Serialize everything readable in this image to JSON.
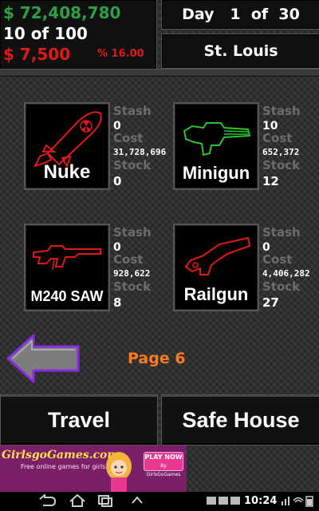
{
  "status": {
    "cash": "$ 72,408,780",
    "capacity": "10  of  100",
    "debt": "$ 7,500",
    "interest": "% 16.00"
  },
  "day": {
    "text": "Day   1  of  30"
  },
  "city": "St. Louis",
  "stat_labels": {
    "stash": "Stash",
    "cost": "Cost",
    "stock": "Stock"
  },
  "items": [
    {
      "name": "Nuke",
      "stash": "0",
      "cost": "31,728,696",
      "stock": "0",
      "outline_color": "#e01818"
    },
    {
      "name": "Minigun",
      "stash": "10",
      "cost": "652,372",
      "stock": "12",
      "outline_color": "#27c42a"
    },
    {
      "name": "M240 SAW",
      "stash": "0",
      "cost": "928,622",
      "stock": "8",
      "outline_color": "#e01818"
    },
    {
      "name": "Railgun",
      "stash": "0",
      "cost": "4,406,282",
      "stock": "27",
      "outline_color": "#e01818"
    }
  ],
  "page": "Page 6",
  "buttons": {
    "travel": "Travel",
    "safe_house": "Safe House"
  },
  "ad": {
    "logo": "GirlsgoGames.com",
    "tagline": "Free online games for girls",
    "play_label": "PLAY NOW",
    "play_sub": "By GirlsGoGames"
  },
  "system": {
    "time": "10:24"
  }
}
